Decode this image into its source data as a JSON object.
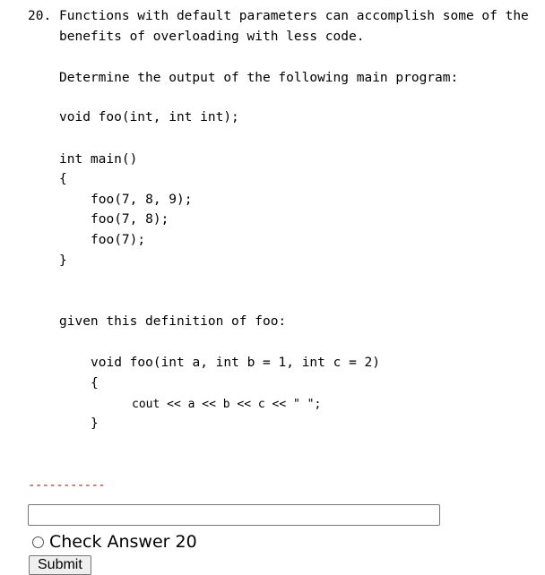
{
  "question": {
    "number": "20.",
    "intro_line1": "Functions with default parameters can accomplish some of the",
    "intro_line2": "benefits of overloading with less code.",
    "prompt": "Determine the output of the following main program:",
    "main_code": [
      "void foo(int, int int);",
      "int main()",
      "{",
      "foo(7, 8, 9);",
      "foo(7, 8);",
      "foo(7);",
      "}"
    ],
    "given": "given this definition of foo:",
    "foo_code": [
      "void foo(int a, int b = 1, int c = 2)",
      "{",
      "cout << a << b << c << \" \";",
      "}"
    ]
  },
  "answer": {
    "dashes": "-----------",
    "input_value": "",
    "radio_label": "Check Answer 20",
    "submit_label": "Submit"
  },
  "colors": {
    "dashes": "#b22222"
  }
}
